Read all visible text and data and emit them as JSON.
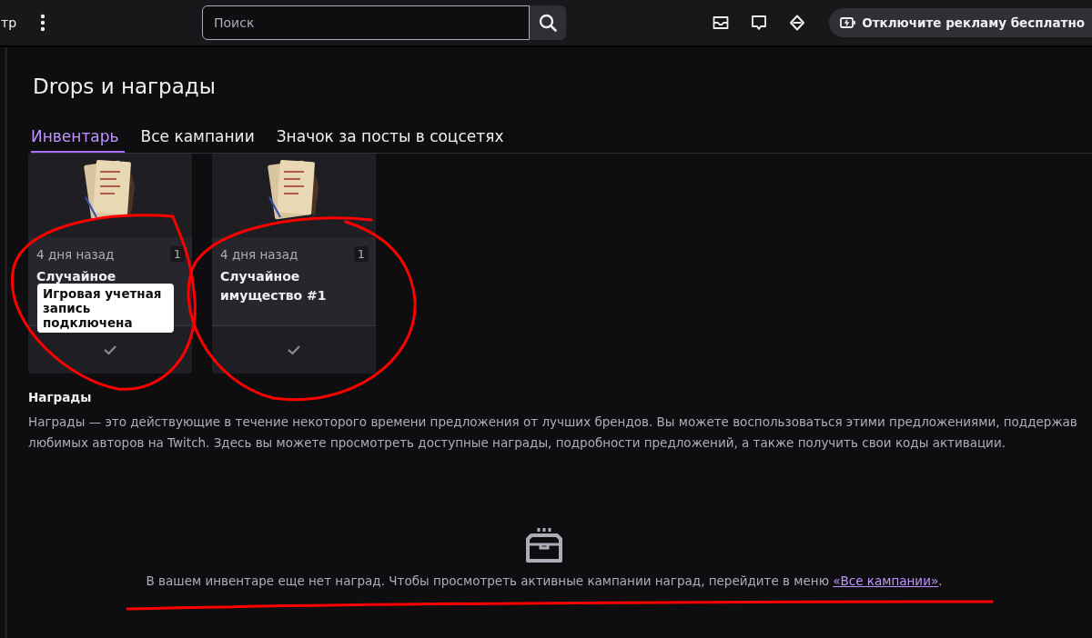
{
  "top_bar": {
    "left_cut_text": "тр",
    "search": {
      "placeholder": "Поиск"
    },
    "promo_button": "Отключите рекламу бесплатно"
  },
  "page": {
    "title": "Drops и награды"
  },
  "tabs": [
    {
      "label": "Инвентарь",
      "selected": true
    },
    {
      "label": "Все кампании",
      "selected": false
    },
    {
      "label": "Значок за посты в соцсетях",
      "selected": false
    }
  ],
  "cards": [
    {
      "time": "4 дня назад",
      "count": "1",
      "title": "Случайное",
      "claimed": true,
      "tooltip": "Игровая учетная запись подключена"
    },
    {
      "time": "4 дня назад",
      "count": "1",
      "title": "Случайное имущество #1",
      "claimed": true
    }
  ],
  "rewards": {
    "heading": "Награды",
    "text": "Награды — это действующие в течение некоторого времени предложения от лучших брендов. Вы можете воспользоваться этими предложениями, поддержав любимых авторов на Twitch. Здесь вы можете просмотреть доступные награды, подробности предложений, а также получить свои коды активации."
  },
  "empty_state": {
    "text": "В вашем инвентаре еще нет наград. Чтобы просмотреть активные кампании наград, перейдите в меню ",
    "link": "«Все кампании»",
    "tail": "."
  },
  "annotations": [
    {
      "kind": "circle"
    },
    {
      "kind": "circle"
    },
    {
      "kind": "underline"
    }
  ]
}
